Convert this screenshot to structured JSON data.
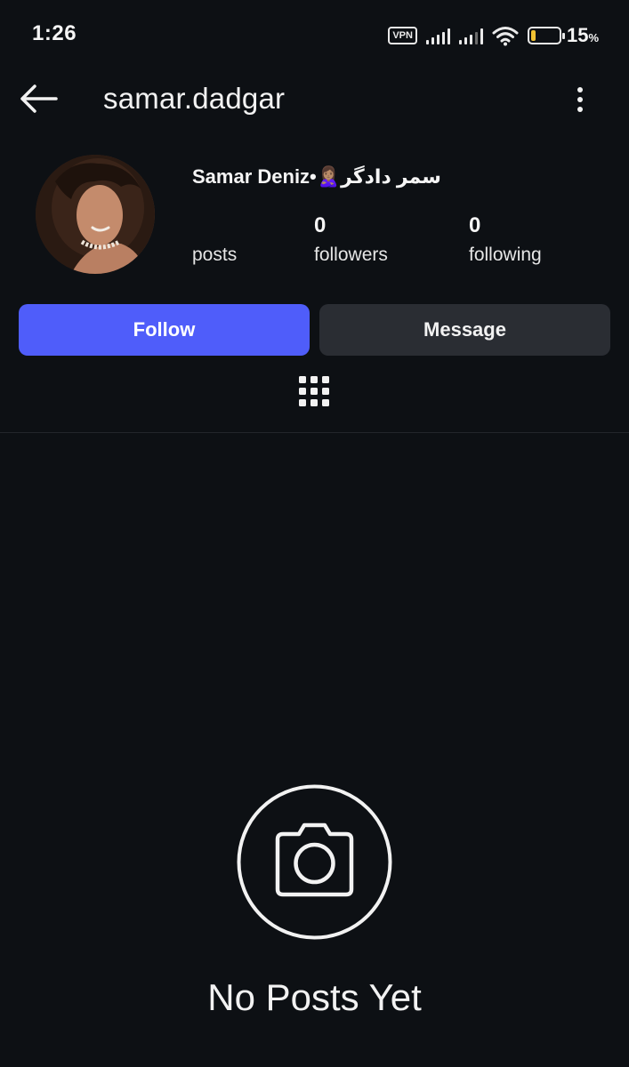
{
  "status_bar": {
    "time": "1:26",
    "vpn_label": "VPN",
    "battery_percent": "15",
    "battery_unit": "%",
    "battery_level": 0.15,
    "battery_color": "#f1c232",
    "icons": [
      "signal-icon",
      "signal-icon",
      "wifi-icon",
      "battery-icon"
    ]
  },
  "top_bar": {
    "username": "samar.dadgar",
    "back_icon": "arrow-left-icon",
    "menu_icon": "more-vertical-icon"
  },
  "profile": {
    "display_name": "Samar Deniz•🙎🏽‍♀️سمر دادگر",
    "stats": {
      "posts": {
        "count": "",
        "label": "posts"
      },
      "followers": {
        "count": "0",
        "label": "followers"
      },
      "following": {
        "count": "0",
        "label": "following"
      }
    }
  },
  "actions": {
    "follow_label": "Follow",
    "message_label": "Message",
    "follow_color": "#4f5dfa",
    "message_color": "#2a2d33"
  },
  "tabs": {
    "grid_icon": "grid-icon"
  },
  "empty_state": {
    "icon": "camera-icon",
    "title": "No Posts Yet"
  }
}
